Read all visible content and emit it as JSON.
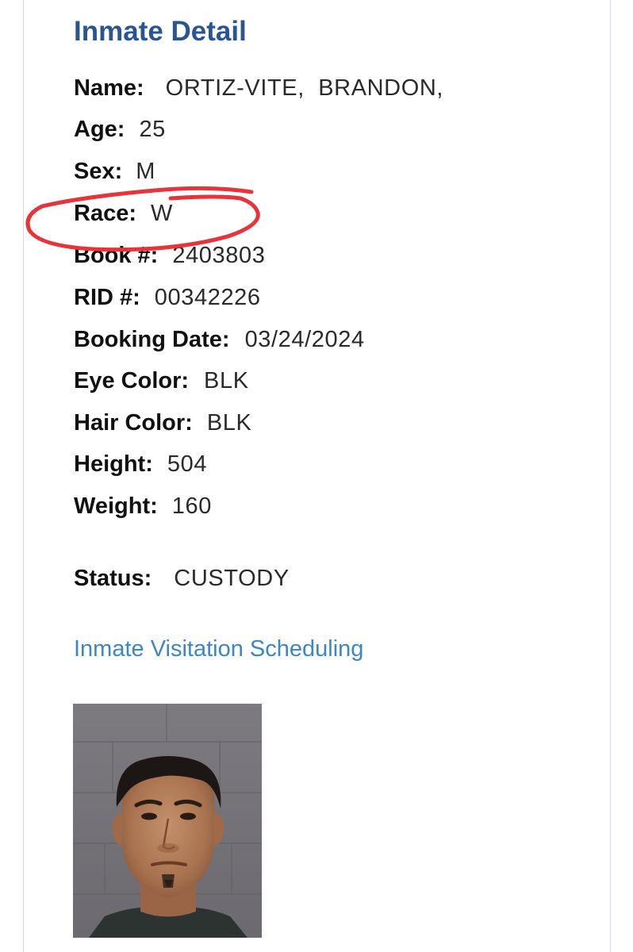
{
  "page": {
    "title": "Inmate Detail",
    "colors": {
      "title": "#2b5592",
      "link": "#3b86c7",
      "annotation": "#e8333a"
    }
  },
  "details": {
    "name": {
      "label": "Name:",
      "value": "ORTIZ-VITE,  BRANDON,"
    },
    "age": {
      "label": "Age:",
      "value": "25"
    },
    "sex": {
      "label": "Sex:",
      "value": "M"
    },
    "race": {
      "label": "Race:",
      "value": "W"
    },
    "book": {
      "label": "Book #:",
      "value": "2403803"
    },
    "rid": {
      "label": "RID #:",
      "value": "00342226"
    },
    "booking_date": {
      "label": "Booking Date:",
      "value": "03/24/2024"
    },
    "eye_color": {
      "label": "Eye Color:",
      "value": "BLK"
    },
    "hair_color": {
      "label": "Hair Color:",
      "value": "BLK"
    },
    "height": {
      "label": "Height:",
      "value": "504"
    },
    "weight": {
      "label": "Weight:",
      "value": "160"
    },
    "status": {
      "label": "Status:",
      "value": "CUSTODY"
    }
  },
  "links": {
    "visitation": "Inmate Visitation Scheduling"
  },
  "photo": {
    "icon": "inmate-mugshot-photo"
  },
  "annotation": {
    "icon": "red-hand-drawn-circle-around-race"
  }
}
